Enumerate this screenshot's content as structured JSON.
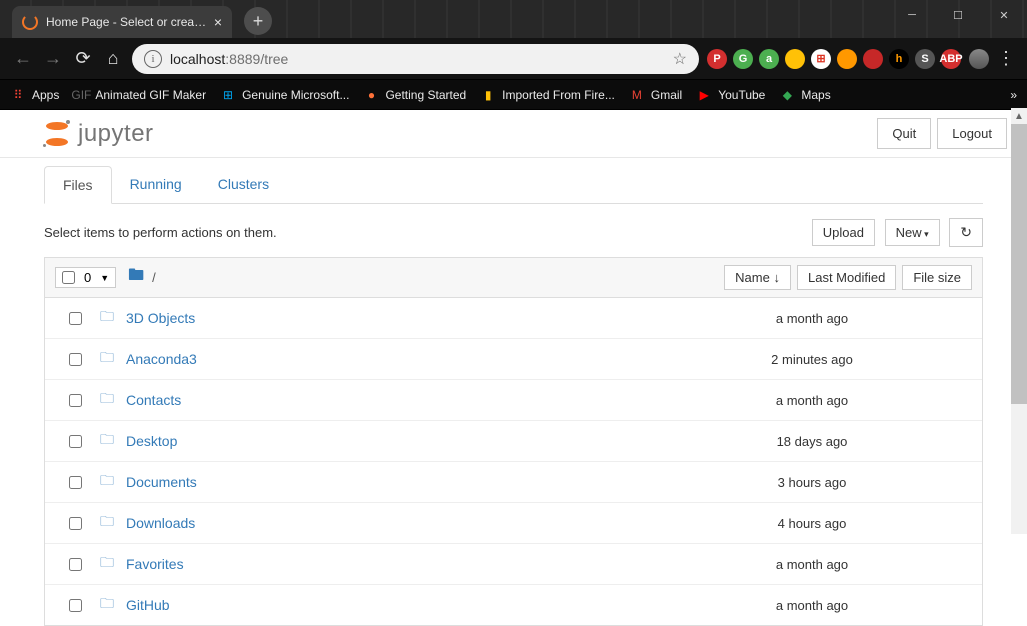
{
  "browser": {
    "tab_title": "Home Page - Select or create a n",
    "url_host": "localhost",
    "url_port": ":8889",
    "url_path": "/tree",
    "extensions": [
      {
        "bg": "#d32f2f",
        "fg": "#fff",
        "label": "P"
      },
      {
        "bg": "#4caf50",
        "fg": "#fff",
        "label": "G"
      },
      {
        "bg": "#4caf50",
        "fg": "#fff",
        "label": "a"
      },
      {
        "bg": "#ffc107",
        "fg": "#333",
        "label": ""
      },
      {
        "bg": "#fff",
        "fg": "#d32",
        "label": "⊞"
      },
      {
        "bg": "#ff9800",
        "fg": "#fff",
        "label": ""
      },
      {
        "bg": "#c62828",
        "fg": "#fff",
        "label": ""
      },
      {
        "bg": "#000",
        "fg": "#f90",
        "label": "h"
      },
      {
        "bg": "#555",
        "fg": "#fff",
        "label": "S"
      },
      {
        "bg": "#d32f2f",
        "fg": "#fff",
        "label": "ABP"
      }
    ],
    "bookmarks": [
      {
        "icon": "⠿",
        "color": "#f44336",
        "label": "Apps"
      },
      {
        "icon": "GIF",
        "color": "#666",
        "label": "Animated GIF Maker"
      },
      {
        "icon": "⊞",
        "color": "#00a4ef",
        "label": "Genuine Microsoft..."
      },
      {
        "icon": "●",
        "color": "#ff7139",
        "label": "Getting Started"
      },
      {
        "icon": "▮",
        "color": "#ffc107",
        "label": "Imported From Fire..."
      },
      {
        "icon": "M",
        "color": "#ea4335",
        "label": "Gmail"
      },
      {
        "icon": "▶",
        "color": "#ff0000",
        "label": "YouTube"
      },
      {
        "icon": "◆",
        "color": "#34a853",
        "label": "Maps"
      }
    ]
  },
  "jupyter": {
    "logo_text": "jupyter",
    "quit": "Quit",
    "logout": "Logout",
    "tabs": [
      {
        "label": "Files",
        "active": true
      },
      {
        "label": "Running",
        "active": false
      },
      {
        "label": "Clusters",
        "active": false
      }
    ],
    "hint": "Select items to perform actions on them.",
    "upload": "Upload",
    "new": "New",
    "refresh": "↻",
    "select_count": "0",
    "breadcrumb_root": "▮",
    "breadcrumb_slash": "/",
    "col_name": "Name",
    "col_modified": "Last Modified",
    "col_size": "File size",
    "items": [
      {
        "name": "3D Objects",
        "modified": "a month ago"
      },
      {
        "name": "Anaconda3",
        "modified": "2 minutes ago"
      },
      {
        "name": "Contacts",
        "modified": "a month ago"
      },
      {
        "name": "Desktop",
        "modified": "18 days ago"
      },
      {
        "name": "Documents",
        "modified": "3 hours ago"
      },
      {
        "name": "Downloads",
        "modified": "4 hours ago"
      },
      {
        "name": "Favorites",
        "modified": "a month ago"
      },
      {
        "name": "GitHub",
        "modified": "a month ago"
      }
    ]
  }
}
